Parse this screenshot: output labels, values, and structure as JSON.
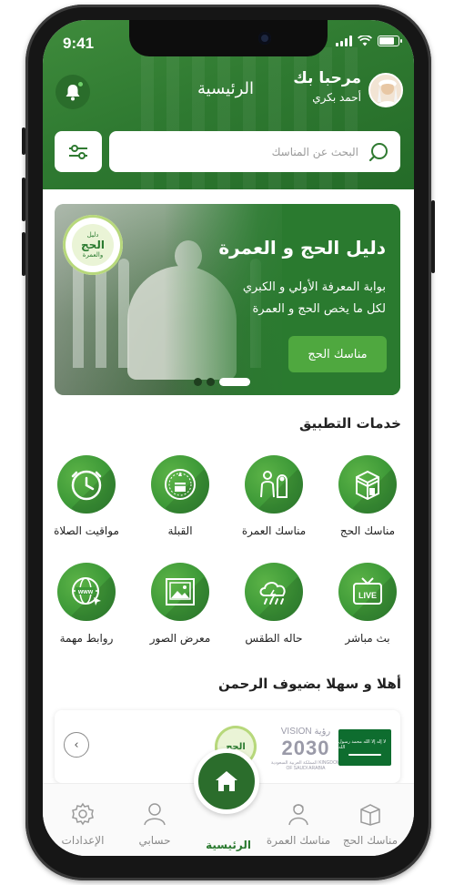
{
  "status_bar": {
    "time": "9:41"
  },
  "header": {
    "title": "الرئيسية",
    "greeting": "مرحبا بك",
    "user_name": "أحمد بكري",
    "search_placeholder": "البحث عن المناسك"
  },
  "banner": {
    "logo_small": "دليل",
    "logo_big": "الحج",
    "logo_sub": "والعمرة",
    "title": "دليل الحج و العمرة",
    "line1": "بوابة المعرفة الأولي و الكبري",
    "line2": "لكل ما يخص الحج و العمرة",
    "button": "مناسك الحج",
    "slide_active_index": 0,
    "slide_count": 3
  },
  "services": {
    "title": "خدمات التطبيق",
    "items": [
      {
        "label": "مناسك الحج",
        "icon": "kaaba-icon"
      },
      {
        "label": "مناسك العمرة",
        "icon": "pilgrims-icon"
      },
      {
        "label": "القبلة",
        "icon": "qibla-compass-icon"
      },
      {
        "label": "مواقيت الصلاة",
        "icon": "clock-icon"
      },
      {
        "label": "بث مباشر",
        "icon": "live-tv-icon"
      },
      {
        "label": "حاله الطقس",
        "icon": "weather-icon"
      },
      {
        "label": "معرض الصور",
        "icon": "gallery-icon"
      },
      {
        "label": "روابط مهمة",
        "icon": "www-globe-icon"
      }
    ]
  },
  "partners": {
    "title": "أهلا و سهلا بضيوف الرحمن",
    "logo_hajj": "الحج",
    "vision_top": "VISION رؤية",
    "vision_year": "2030",
    "vision_sub": "المملكة العربية السعودية KINGDOM OF SAUDI ARABIA",
    "flag_text": "لا إله إلا الله محمد رسول الله"
  },
  "bottom_nav": {
    "hajj": "مناسك الحج",
    "umrah": "مناسك العمرة",
    "home": "الرئيسية",
    "account": "حسابي",
    "settings": "الإعدادات"
  },
  "colors": {
    "primary": "#2f7a31",
    "primary_dark": "#2b6d2c",
    "accent": "#4fa83f",
    "icon_green": "#3e9a38"
  }
}
